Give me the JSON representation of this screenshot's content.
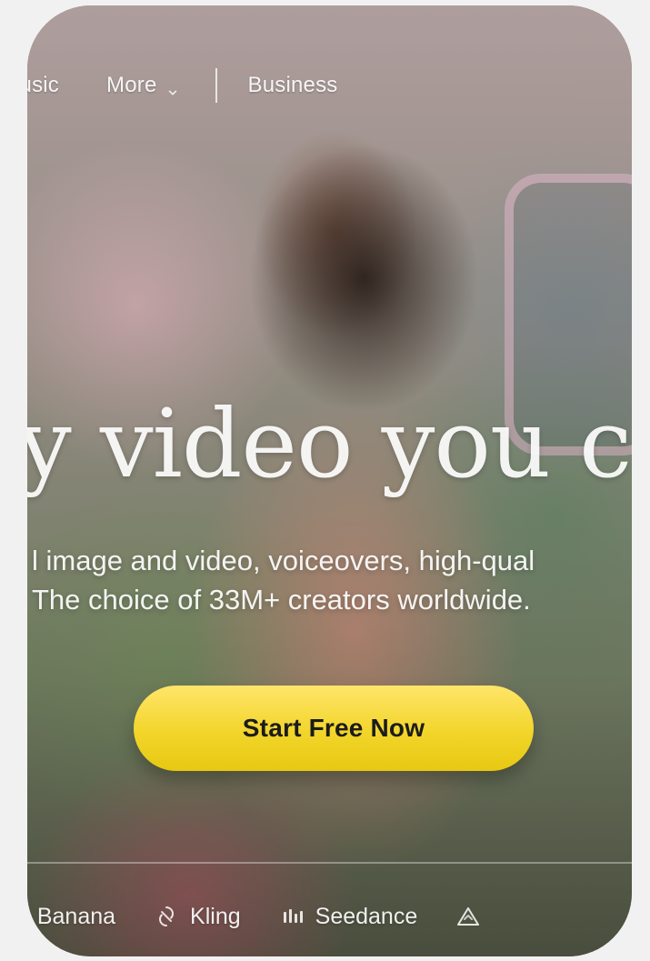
{
  "nav": {
    "items": [
      {
        "label": "lusic"
      },
      {
        "label": "More"
      },
      {
        "label": "Business"
      }
    ],
    "more_chevron_icon": "chevron-down-icon"
  },
  "hero": {
    "headline": "y video you ca",
    "subtext_line1": "l image and video, voiceovers, high-qual",
    "subtext_line2": "The choice of 33M+ creators worldwide.",
    "cta_label": "Start Free Now",
    "cta_color": "#f2d52a"
  },
  "bottom_strip": {
    "items": [
      {
        "label": "o Banana",
        "icon": ""
      },
      {
        "label": "Kling",
        "icon": "kling-icon"
      },
      {
        "label": "Seedance",
        "icon": "seedance-icon"
      },
      {
        "label": "",
        "icon": "delta-icon"
      }
    ]
  }
}
